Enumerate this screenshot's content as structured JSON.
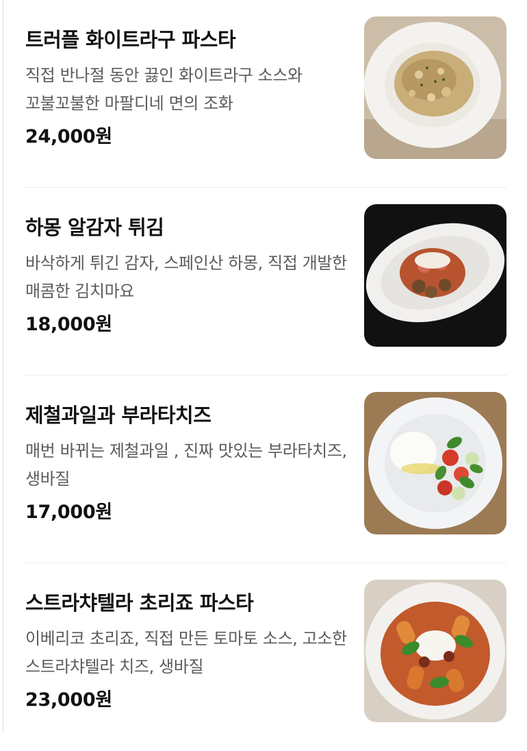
{
  "menu": {
    "items": [
      {
        "name": "트러플 화이트라구 파스타",
        "description": "직접 반나절 동안 끓인 화이트라구 소스와 꼬불꼬불한 마팔디네 면의 조화",
        "price": "24,000원",
        "image_icon": "pasta-white-ragu-photo"
      },
      {
        "name": "하몽 알감자 튀김",
        "description": "바삭하게 튀긴 감자, 스페인산 하몽, 직접 개발한 매콤한 김치마요",
        "price": "18,000원",
        "image_icon": "fried-potato-jamon-photo"
      },
      {
        "name": "제철과일과 부라타치즈",
        "description": "매번 바뀌는 제철과일 , 진짜 맛있는 부라타치즈, 생바질",
        "price": "17,000원",
        "image_icon": "burrata-fruit-salad-photo"
      },
      {
        "name": "스트라챠텔라 초리죠 파스타",
        "description": "이베리코 초리죠, 직접 만든 토마토 소스, 고소한 스트라챠텔라 치즈, 생바질",
        "price": "23,000원",
        "image_icon": "chorizo-rigatoni-photo"
      }
    ]
  }
}
